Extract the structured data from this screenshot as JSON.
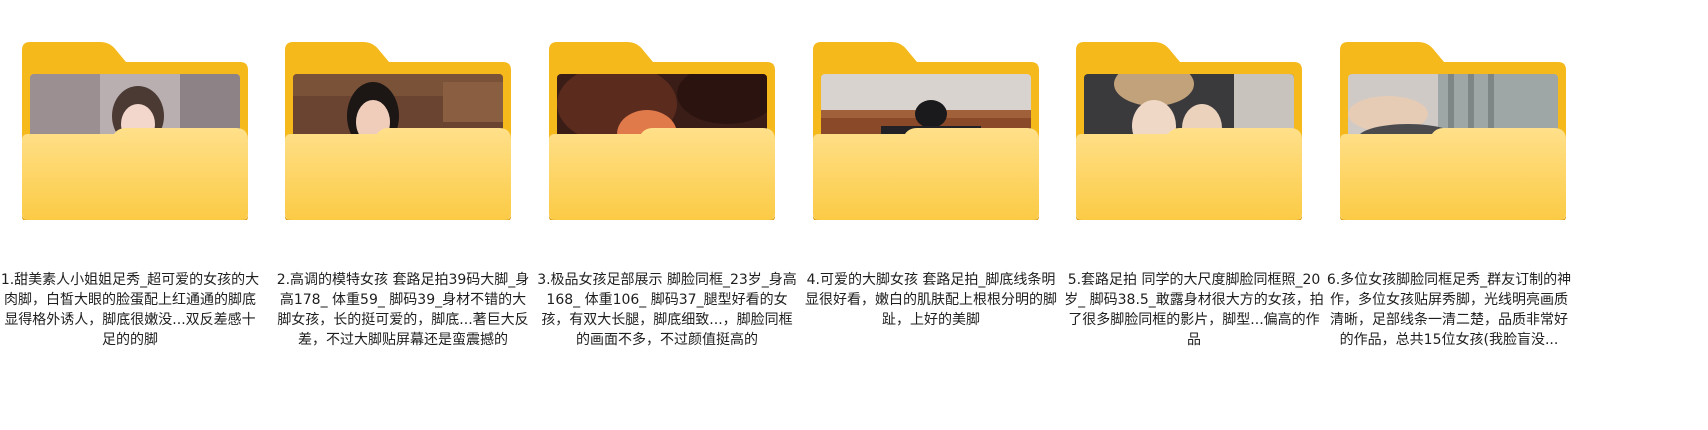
{
  "folders": [
    {
      "caption": "1.甜美素人小姐姐足秀_超可爱的女孩的大肉脚，白皙大眼的脸蛋配上红通通的脚底显得格外诱人，脚底很嫩没...双反差感十足的的脚",
      "thumbnail": "girl-face-thumbnail"
    },
    {
      "caption": "2.高调的模特女孩 套路足拍39码大脚_身高178_ 体重59_ 脚码39_身材不错的大脚女孩，长的挺可爱的，脚底...著巨大反差，不过大脚贴屏幕还是蛮震撼的",
      "thumbnail": "girl-portrait-thumbnail"
    },
    {
      "caption": "3.极品女孩足部展示 脚脸同框_23岁_身高168_ 体重106_ 脚码37_腿型好看的女孩，有双大长腿，脚底细致...，脚脸同框的画面不多，不过颜值挺高的",
      "thumbnail": "closeup-thumbnail"
    },
    {
      "caption": "4.可爱的大脚女孩 套路足拍_脚底线条明显很好看，嫩白的肌肤配上根根分明的脚趾，上好的美脚",
      "thumbnail": "room-thumbnail"
    },
    {
      "caption": "5.套路足拍 同学的大尺度脚脸同框照_20岁_ 脚码38.5_敢露身材很大方的女孩，拍了很多脚脸同框的影片，脚型...偏高的作品",
      "thumbnail": "knees-thumbnail"
    },
    {
      "caption": "6.多位女孩脚脸同框足秀_群友订制的神作，多位女孩贴屏秀脚，光线明亮画质清晰，足部线条一清二楚，品质非常好的作品，总共15位女孩(我脸盲没...",
      "thumbnail": "legs-thumbnail"
    }
  ],
  "colors": {
    "folder_back": "#F6B91C",
    "folder_front_top": "#FFE08A",
    "folder_front_bottom": "#FCCB45",
    "folder_front_edge": "#E9A81A",
    "caption_text": "#1E1E1E"
  }
}
